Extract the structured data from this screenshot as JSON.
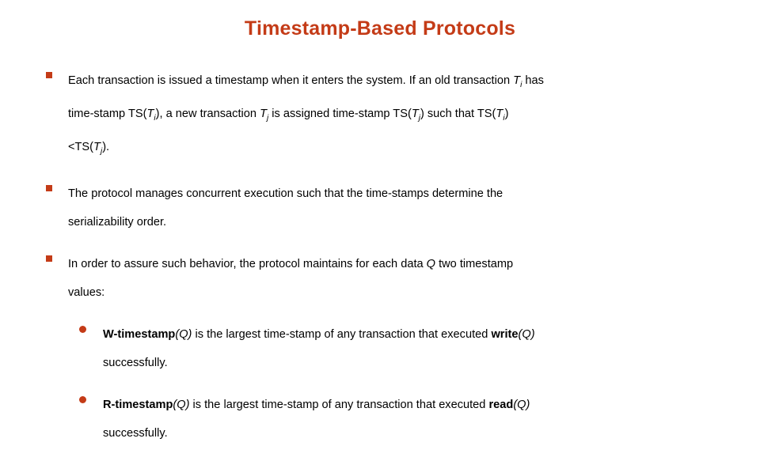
{
  "slide": {
    "title": "Timestamp-Based Protocols",
    "title_color": "#C43B17",
    "bullet_marker_color": "#C43B17",
    "bullets": [
      {
        "level": 1,
        "marker": "square-bullet",
        "lines": [
          "Each transaction is issued a timestamp when it enters the system. If an old transaction T",
          "i",
          " has",
          "time-stamp  TS(",
          "T",
          "i",
          "),  a  new  transaction  ",
          "T",
          "j",
          "  is  assigned  time-stamp  TS(",
          "T",
          "j",
          ")  such  that  TS(",
          "T",
          "i",
          ")",
          "<TS(",
          "T",
          "j",
          ")."
        ],
        "text": "Each transaction is issued a timestamp when it enters the system. If an old transaction Ti has time-stamp TS(Ti), a new transaction Tj is assigned time-stamp TS(Tj) such that TS(Ti) <TS(Tj)."
      },
      {
        "level": 1,
        "marker": "square-bullet",
        "text": "The protocol manages concurrent execution such that the time-stamps determine the serializability order."
      },
      {
        "level": 1,
        "marker": "square-bullet",
        "text": "In order to assure such behavior, the protocol maintains for each data Q two timestamp values:"
      },
      {
        "level": 2,
        "marker": "round-bullet",
        "term": "W-timestamp",
        "term_arg": "(Q)",
        "text": "is the largest time-stamp of any transaction that executed write(Q) successfully.",
        "keyword": "write",
        "keyword_arg": "(Q)"
      },
      {
        "level": 2,
        "marker": "round-bullet",
        "term": "R-timestamp",
        "term_arg": "(Q)",
        "text": "is the largest time-stamp of any transaction that executed read(Q) successfully.",
        "keyword": "read",
        "keyword_arg": "(Q)"
      }
    ],
    "fragments": {
      "b1_a": "Each transaction is issued a timestamp when it enters the system. If an old transaction ",
      "b1_T1": "T",
      "b1_sub1": "i",
      "b1_b": " has",
      "b1_c": "time-stamp  TS(",
      "b1_T2": "T",
      "b1_sub2": "i",
      "b1_d": "),  a  new  transaction  ",
      "b1_T3": "T",
      "b1_sub3": "j",
      "b1_e": "  is  assigned  time-stamp  TS(",
      "b1_T4": "T",
      "b1_sub4": "j",
      "b1_f": ")  such  that  TS(",
      "b1_T5": "T",
      "b1_sub5": "i",
      "b1_g": ")",
      "b1_h": "<TS(",
      "b1_T6": "T",
      "b1_sub6": "j",
      "b1_i": ").",
      "b2_a": "The  protocol  manages  concurrent  execution  such  that  the  time-stamps  determine  the",
      "b2_b": "serializability order.",
      "b3_a": "In  order  to  assure  such  behavior,  the  protocol  maintains  for  each  data  ",
      "b3_Q": "Q",
      "b3_b": "  two  timestamp",
      "b3_c": "values:",
      "b4_term": "W-timestamp",
      "b4_arg": "(Q)",
      "b4_a": "  is  the  largest  time-stamp  of  any  transaction  that  executed  ",
      "b4_kw": "write",
      "b4_kwarg": "(Q)",
      "b4_b": "successfully.",
      "b5_term": "R-timestamp",
      "b5_arg": "(Q)",
      "b5_a": "  is  the  largest  time-stamp  of  any  transaction  that  executed  ",
      "b5_kw": "read",
      "b5_kwarg": "(Q)",
      "b5_b": "successfully."
    }
  }
}
